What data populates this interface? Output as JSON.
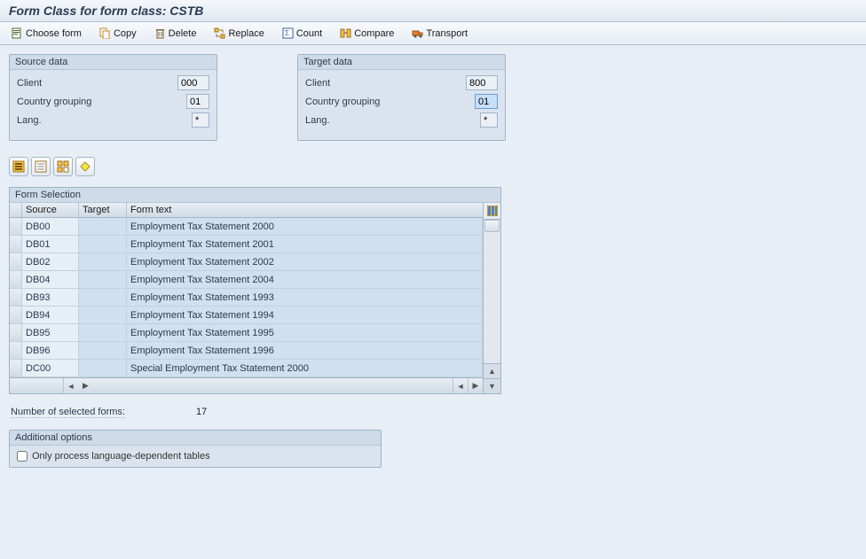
{
  "header": {
    "title": "Form Class for form class: CSTB"
  },
  "toolbar": {
    "choose_form": "Choose form",
    "copy": "Copy",
    "delete": "Delete",
    "replace": "Replace",
    "count": "Count",
    "compare": "Compare",
    "transport": "Transport"
  },
  "source_panel": {
    "title": "Source data",
    "client_label": "Client",
    "client_value": "000",
    "cg_label": "Country grouping",
    "cg_value": "01",
    "lang_label": "Lang.",
    "lang_value": "*"
  },
  "target_panel": {
    "title": "Target data",
    "client_label": "Client",
    "client_value": "800",
    "cg_label": "Country grouping",
    "cg_value": "01",
    "lang_label": "Lang.",
    "lang_value": "*"
  },
  "form_selection": {
    "title": "Form Selection",
    "col_source": "Source",
    "col_target": "Target",
    "col_text": "Form text",
    "rows": [
      {
        "source": "DB00",
        "target": "",
        "text": "Employment Tax Statement 2000"
      },
      {
        "source": "DB01",
        "target": "",
        "text": "Employment Tax Statement 2001"
      },
      {
        "source": "DB02",
        "target": "",
        "text": "Employment Tax Statement 2002"
      },
      {
        "source": "DB04",
        "target": "",
        "text": "Employment Tax Statement 2004"
      },
      {
        "source": "DB93",
        "target": "",
        "text": "Employment Tax Statement 1993"
      },
      {
        "source": "DB94",
        "target": "",
        "text": "Employment Tax Statement 1994"
      },
      {
        "source": "DB95",
        "target": "",
        "text": "Employment Tax Statement 1995"
      },
      {
        "source": "DB96",
        "target": "",
        "text": "Employment Tax Statement 1996"
      },
      {
        "source": "DC00",
        "target": "",
        "text": "Special Employment Tax Statement 2000"
      }
    ]
  },
  "count": {
    "label": "Number of selected forms:",
    "value": "17"
  },
  "options": {
    "title": "Additional options",
    "chk_label": "Only process language-dependent tables"
  }
}
